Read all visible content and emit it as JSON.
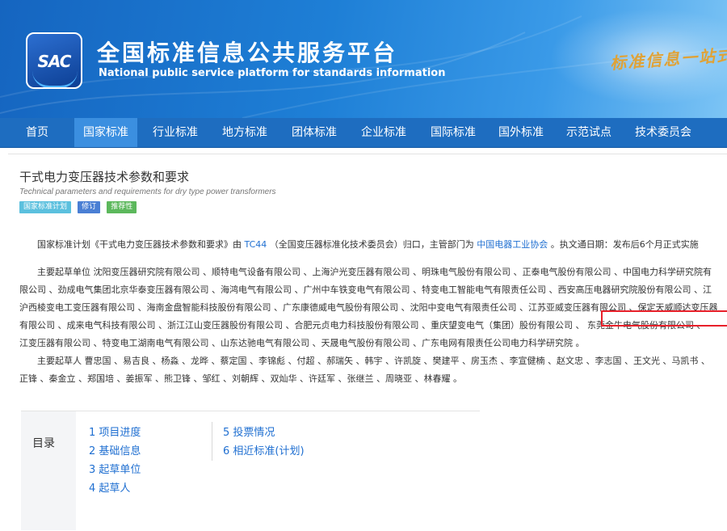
{
  "header": {
    "logo_text": "SAC",
    "title_cn": "全国标准信息公共服务平台",
    "title_en": "National public service platform  for standards information",
    "slogan": "标准信息一站式"
  },
  "nav": {
    "items": [
      "首页",
      "国家标准",
      "行业标准",
      "地方标准",
      "团体标准",
      "企业标准",
      "国际标准",
      "国外标准",
      "示范试点",
      "技术委员会"
    ],
    "active": "国家标准"
  },
  "standard": {
    "title_cn": "干式电力变压器技术参数和要求",
    "title_en": "Technical parameters and requirements for dry type power transformers",
    "badges": [
      "国家标准计划",
      "修订",
      "推荐性"
    ]
  },
  "intro": {
    "before_tc": "国家标准计划《干式电力变压器技术参数和要求》由",
    "tc_link": "TC44",
    "after_tc": "（全国变压器标准化技术委员会）归口，主管部门为",
    "dept_link": "中国电器工业协会",
    "after_dept": "。执文通日期：发布后6个月正式实施"
  },
  "drafting_units": {
    "lines": [
      "主要起草单位 沈阳变压器研究院有限公司 、顺特电气设备有限公司 、上海沪光变压器有限公司 、明珠电气股份有限公司 、正泰电气股份有限公司 、中国电力科学研究院有",
      "限公司 、劲成电气集团北京华泰变压器有限公司 、海鸿电气有限公司 、广州中车铁变电气有限公司 、特变电工智能电气有限责任公司 、西安高压电器研究院股份有限公司 、江",
      "沪西棱变电工变压器有限公司 、海南金盘智能科技股份有限公司 、广东康德威电气股份有限公司 、沈阳中变电气有限责任公司 、江苏亚威变压器有限公司 、保定天威顺达变压器",
      "有限公司 、成来电气科技有限公司 、浙江江山变压器股份有限公司 、合肥元贞电力科技股份有限公司 、重庆望变电气（集团）股份有限公司 、 东莞金牛电气股份有限公司 、",
      "江变压器有限公司 、特变电工湖南电气有限公司 、山东达驰电气有限公司 、天晟电气股份有限公司 、广东电网有限责任公司电力科学研究院 。"
    ]
  },
  "drafters": {
    "lines": [
      "主要起草人 曹忠国 、易吉良 、杨淼 、龙晔 、蔡定国 、李锦彪 、付超 、郝瑞矢 、韩宇 、许凯旋 、樊建平 、房玉杰 、李宣健楠 、赵文忠 、李志国 、王文光 、马凯书 、",
      "正锋 、秦金立 、郑国培 、姜振军 、熊卫锋 、邹红 、刘朝辉 、双灿华 、许廷军 、张继兰 、周晓亚 、林春耀 。"
    ]
  },
  "toc": {
    "label": "目录",
    "left": [
      "1  项目进度",
      "2  基础信息",
      "3  起草单位",
      "4  起草人"
    ],
    "right": [
      "5  投票情况",
      "6  相近标准(计划)"
    ]
  }
}
